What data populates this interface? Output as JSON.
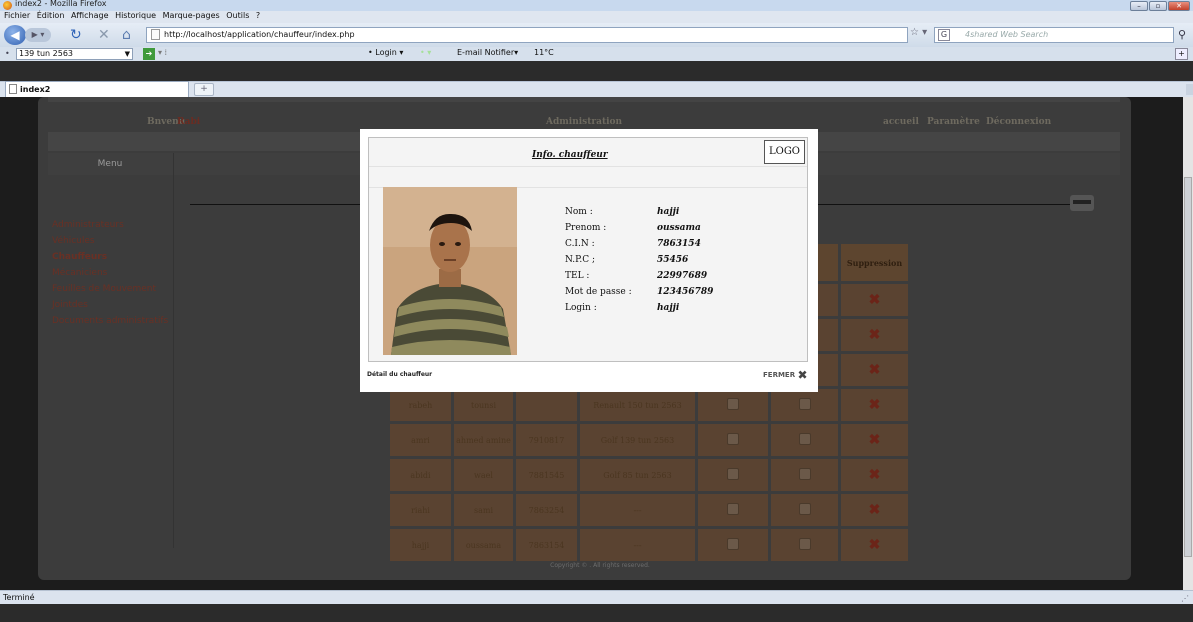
{
  "window": {
    "title": "index2 - Mozilla Firefox"
  },
  "menubar": [
    "Fichier",
    "Édition",
    "Affichage",
    "Historique",
    "Marque-pages",
    "Outils",
    "?"
  ],
  "nav": {
    "url": "http://localhost/application/chauffeur/index.php",
    "search_placeholder": "4shared Web Search"
  },
  "toolbar2": {
    "plate_value": "139 tun 2563",
    "login_label": "Login",
    "email_label": "E-mail Notifier",
    "temperature": "11°C"
  },
  "tab": {
    "title": "index2"
  },
  "page": {
    "header_left": "Bnvenu",
    "header_left_name": "Rabi",
    "header_center": "Administration",
    "header_right": [
      "accueil",
      "Paramètre",
      "Déconnexion"
    ],
    "menu_title": "Menu",
    "sidebar": [
      "Administrateurs",
      "Véhicules",
      "Chauffeurs",
      "Mécaniciens",
      "Feuilles de Mouvement",
      "Jointdes",
      "Documents administratifs"
    ],
    "table_headers": [
      "",
      "",
      "",
      "",
      "",
      "tion",
      "Suppression"
    ],
    "rows": [
      {
        "nom": "",
        "prenom": "",
        "cin": "",
        "vehicule": ""
      },
      {
        "nom": "",
        "prenom": "",
        "cin": "",
        "vehicule": ""
      },
      {
        "nom": "",
        "prenom": "",
        "cin": "",
        "vehicule": ""
      },
      {
        "nom": "rabeh",
        "prenom": "tounsi",
        "cin": "",
        "vehicule": "Renault  150 tun 2563"
      },
      {
        "nom": "amri",
        "prenom": "ahmed amine",
        "cin": "7910817",
        "vehicule": "Golf  139 tun 2563"
      },
      {
        "nom": "abidi",
        "prenom": "wael",
        "cin": "7881545",
        "vehicule": "Golf  85 tun 2563"
      },
      {
        "nom": "riahi",
        "prenom": "sami",
        "cin": "7863254",
        "vehicule": "---"
      },
      {
        "nom": "hajji",
        "prenom": "oussama",
        "cin": "7863154",
        "vehicule": "---"
      }
    ],
    "copyright": "Copyright © . All rights reserved."
  },
  "modal": {
    "title": "Info. chauffeur",
    "logo": "LOGO",
    "fields": [
      {
        "label": "Nom :",
        "value": "hajji"
      },
      {
        "label": "Prenom :",
        "value": "oussama"
      },
      {
        "label": "C.I.N :",
        "value": "7863154"
      },
      {
        "label": "N.P.C ;",
        "value": "55456"
      },
      {
        "label": "TEL :",
        "value": "22997689"
      },
      {
        "label": "Mot de passe :",
        "value": "123456789"
      },
      {
        "label": "Login :",
        "value": "hajji"
      }
    ],
    "footer_text": "Détail du chauffeur",
    "close_label": "FERMER"
  },
  "status": {
    "text": "Terminé"
  }
}
